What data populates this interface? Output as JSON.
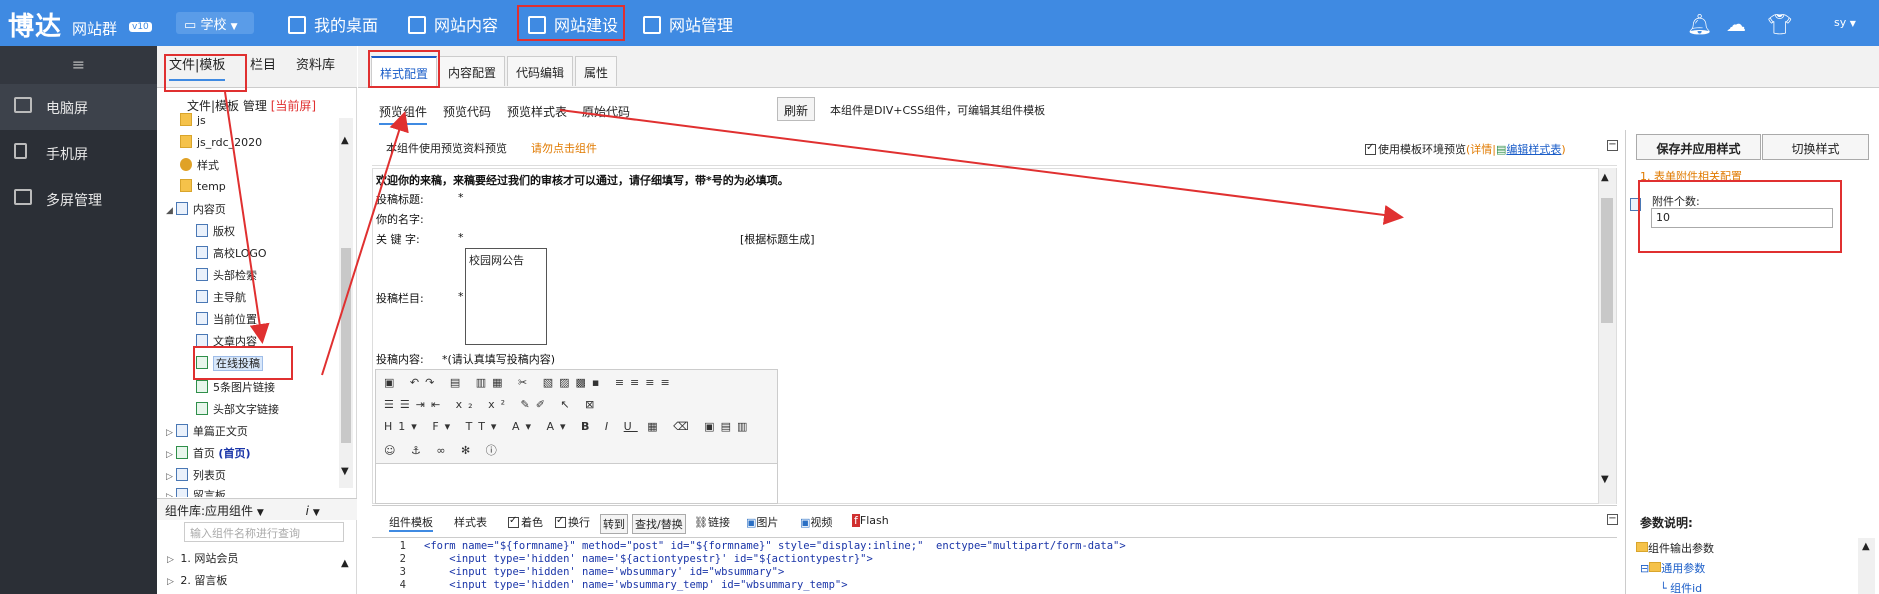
{
  "topbar": {
    "logo": "博达",
    "logo_sub": "网站群",
    "version": "v10",
    "site_switch": "学校",
    "nav": [
      "我的桌面",
      "网站内容",
      "网站建设",
      "网站管理"
    ],
    "user": "sy"
  },
  "sidebar": {
    "items": [
      "电脑屏",
      "手机屏",
      "多屏管理"
    ]
  },
  "tree_panel": {
    "tabs": [
      "文件|模板",
      "栏目",
      "资料库"
    ],
    "sub_header": "文件|模板 管理",
    "sub_header_scope": "[当前屏]",
    "rows": [
      {
        "label": "js",
        "type": "folder"
      },
      {
        "label": "js_rdc_2020",
        "type": "folder"
      },
      {
        "label": "样式",
        "type": "style"
      },
      {
        "label": "temp",
        "type": "folder"
      },
      {
        "label": "内容页",
        "type": "file",
        "expanded": true
      },
      {
        "label": "版权",
        "type": "file"
      },
      {
        "label": "高校LOGO",
        "type": "file"
      },
      {
        "label": "头部检索",
        "type": "file"
      },
      {
        "label": "主导航",
        "type": "file"
      },
      {
        "label": "当前位置",
        "type": "file"
      },
      {
        "label": "文章内容",
        "type": "file"
      },
      {
        "label": "在线投稿",
        "type": "file2",
        "selected": true
      },
      {
        "label": "5条图片链接",
        "type": "file2"
      },
      {
        "label": "头部文字链接",
        "type": "file2"
      },
      {
        "label": "单篇正文页",
        "type": "file",
        "collapsed": true
      },
      {
        "label": "首页",
        "suffix": "(首页)",
        "type": "file2",
        "collapsed": true
      },
      {
        "label": "列表页",
        "type": "file",
        "collapsed": true
      },
      {
        "label": "留言板",
        "type": "file",
        "collapsed": true
      }
    ],
    "library_label": "组件库:",
    "library_value": "应用组件",
    "library_search_placeholder": "输入组件名称进行查询",
    "library_rows": [
      "1. 网站会员",
      "2. 留言板"
    ]
  },
  "main": {
    "tabs": [
      "样式配置",
      "内容配置",
      "代码编辑",
      "属性"
    ],
    "subtabs": [
      "预览组件",
      "预览代码",
      "预览样式表",
      "原始代码"
    ],
    "refresh_label": "刷新",
    "component_desc": "本组件是DIV+CSS组件，可编辑其组件模板",
    "preview_hint": "本组件使用预览资料预览",
    "preview_warn": "请勿点击组件",
    "env_preview": "使用模板环境预览",
    "env_detail": "(详情",
    "env_edit_link": "编辑样式表",
    "preview": {
      "welcome": "欢迎你的来稿，来稿要经过我们的审核才可以通过，请仔细填写，带*号的为必填项。",
      "title_label": "投稿标题:",
      "name_label": "你的名字:",
      "keywords_label": "关 键 字:",
      "required_mark": "*",
      "keywords_hint": "[根据标题生成]",
      "column_label": "投稿栏目:",
      "column_option": "校园网公告",
      "content_label": "投稿内容:",
      "content_hint": "*(请认真填写投稿内容)",
      "toolbar_row3_items": [
        "H1",
        "F",
        "TT"
      ]
    }
  },
  "right_panel": {
    "save_apply": "保存并应用样式",
    "switch_style": "切换样式",
    "section": "1. 表单附件相关配置",
    "attachment_label": "附件个数:",
    "attachment_value": "10"
  },
  "code_bar": {
    "tabs": [
      "组件模板",
      "样式表"
    ],
    "color": "着色",
    "wrap": "换行",
    "goto": "转到",
    "find_replace": "查找/替换",
    "link": "链接",
    "image": "图片",
    "video": "视频",
    "flash": "Flash"
  },
  "code_lines": [
    {
      "n": "1",
      "text": "<form name=\"${formname}\" method=\"post\" id=\"${formname}\" style=\"display:inline;\"  enctype=\"multipart/form-data\">"
    },
    {
      "n": "2",
      "text": "    <input type='hidden' name='${actiontypestr}' id=\"${actiontypestr}\">"
    },
    {
      "n": "3",
      "text": "    <input type='hidden' name='wbsummary' id=\"wbsummary\">"
    },
    {
      "n": "4",
      "text": "    <input type='hidden' name='wbsummary_temp' id=\"wbsummary_temp\">"
    }
  ],
  "params": {
    "title": "参数说明:",
    "rows": [
      "组件输出参数",
      "通用参数",
      "组件id"
    ]
  }
}
